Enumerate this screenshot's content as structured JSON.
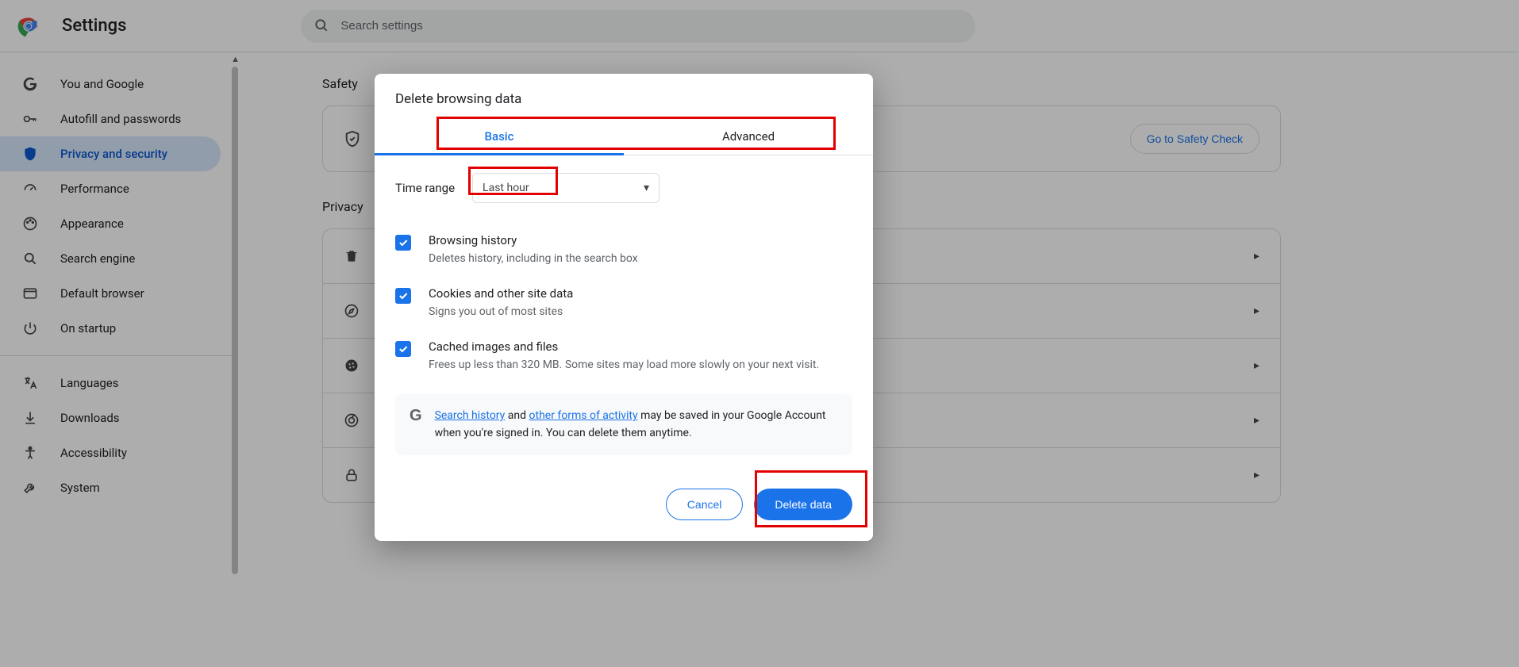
{
  "header": {
    "title": "Settings",
    "search_placeholder": "Search settings"
  },
  "sidebar": {
    "items": [
      {
        "label": "You and Google"
      },
      {
        "label": "Autofill and passwords"
      },
      {
        "label": "Privacy and security"
      },
      {
        "label": "Performance"
      },
      {
        "label": "Appearance"
      },
      {
        "label": "Search engine"
      },
      {
        "label": "Default browser"
      },
      {
        "label": "On startup"
      }
    ],
    "items2": [
      {
        "label": "Languages"
      },
      {
        "label": "Downloads"
      },
      {
        "label": "Accessibility"
      },
      {
        "label": "System"
      }
    ]
  },
  "main": {
    "safety_heading": "Safety",
    "safety_button": "Go to Safety Check",
    "privacy_heading": "Privacy"
  },
  "modal": {
    "title": "Delete browsing data",
    "tabs": {
      "basic": "Basic",
      "advanced": "Advanced"
    },
    "time_label": "Time range",
    "time_value": "Last hour",
    "options": [
      {
        "title": "Browsing history",
        "desc": "Deletes history, including in the search box"
      },
      {
        "title": "Cookies and other site data",
        "desc": "Signs you out of most sites"
      },
      {
        "title": "Cached images and files",
        "desc": "Frees up less than 320 MB. Some sites may load more slowly on your next visit."
      }
    ],
    "info": {
      "link1": "Search history",
      "mid1": " and ",
      "link2": "other forms of activity",
      "rest": " may be saved in your Google Account when you're signed in. You can delete them anytime."
    },
    "cancel": "Cancel",
    "delete": "Delete data"
  }
}
